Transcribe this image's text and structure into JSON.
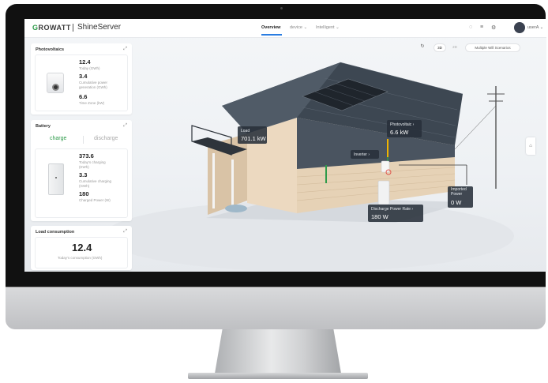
{
  "brand": {
    "logo_first": "G",
    "logo_rest": "ROWATT",
    "product": "ShineServer"
  },
  "nav": {
    "overview": "Overview",
    "device": "device",
    "intelligent": "Intelligent",
    "user": "userA"
  },
  "icons": {
    "bell": "bell-icon",
    "list": "list-icon",
    "settings": "settings-icon",
    "avatar": "avatar-icon",
    "refresh": "refresh-icon"
  },
  "view": {
    "mode_3d": "3D",
    "mode_2d": "2D",
    "scenarios": "Multiple Will Scenarios"
  },
  "photovoltaics": {
    "title": "Photovoltaics",
    "today_value": "12.4",
    "today_label": "Today (GWh)",
    "cumulative_value": "3.4",
    "cumulative_label_1": "Cumulative power",
    "cumulative_label_2": "generation (GWh)",
    "time_zone_value": "6.6",
    "time_zone_label": "Time Zone (kW)"
  },
  "battery": {
    "title": "Battery",
    "tab_charge": "charge",
    "tab_discharge": "discharge",
    "today_value": "373.6",
    "today_label_1": "Today's charging",
    "today_label_2": "(KWh)",
    "cumulative_value": "3.3",
    "cumulative_label_1": "Cumulative charging",
    "cumulative_label_2": "(GWh)",
    "power_value": "180",
    "power_label": "Charged Power (W)"
  },
  "load_consumption": {
    "title": "Load consumption",
    "value": "12.4",
    "label": "Today's consumption (GWh)"
  },
  "scene": {
    "load_label": "Load",
    "load_value": "701.1 kW",
    "pv_label": "Photovoltaic",
    "pv_value": "6.6 kW",
    "inverter_label": "Inverter",
    "discharge_label": "Discharge Power Rate",
    "discharge_value": "180 W",
    "imported_label_1": "Imported",
    "imported_label_2": "Power",
    "imported_value": "0 W"
  },
  "colors": {
    "accent": "#2a7de1",
    "green": "#2e9b4a",
    "roof": "#3d4752",
    "wall": "#e9d7bf"
  }
}
